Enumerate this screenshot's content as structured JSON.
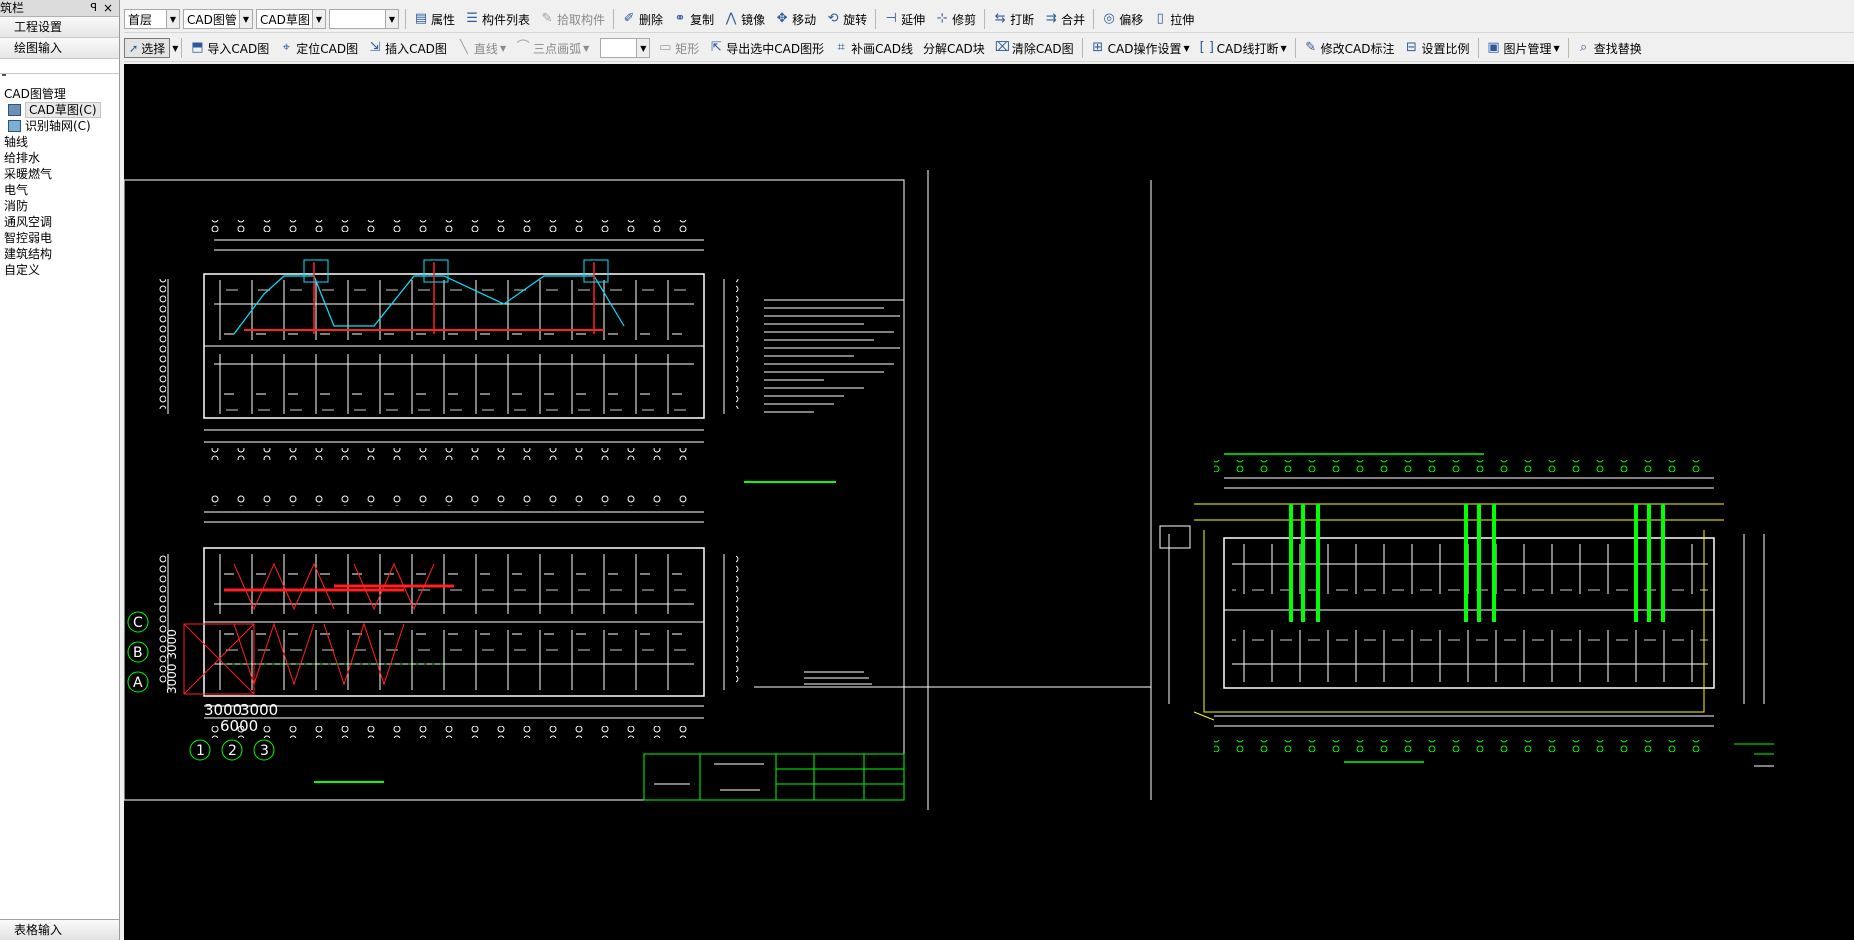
{
  "sidebar": {
    "title": "筑栏",
    "pin": "ꟼ",
    "close": "×",
    "buttons": [
      "工程设置",
      "绘图输入"
    ],
    "tree_header": "CAD图管理",
    "tree_sub": [
      "CAD草图(C)",
      "识别轴网(C)"
    ],
    "categories": [
      "轴线",
      "给排水",
      "采暖燃气",
      "电气",
      "消防",
      "通风空调",
      "智控弱电",
      "建筑结构",
      "自定义"
    ],
    "bottom": "表格输入"
  },
  "toolbar1": {
    "floor": "首层",
    "cad_mgr": "CAD图管",
    "cad_draft": "CAD草图",
    "blank": "",
    "items": [
      {
        "label": "属性",
        "icon": "props-icon"
      },
      {
        "label": "构件列表",
        "icon": "list-icon"
      },
      {
        "label": "拾取构件",
        "icon": "pick-icon",
        "dim": true
      },
      {
        "label": "删除",
        "icon": "delete-icon"
      },
      {
        "label": "复制",
        "icon": "copy-icon"
      },
      {
        "label": "镜像",
        "icon": "mirror-icon"
      },
      {
        "label": "移动",
        "icon": "move-icon"
      },
      {
        "label": "旋转",
        "icon": "rotate-icon"
      },
      {
        "label": "延伸",
        "icon": "extend-icon"
      },
      {
        "label": "修剪",
        "icon": "trim-icon"
      },
      {
        "label": "打断",
        "icon": "break-icon"
      },
      {
        "label": "合并",
        "icon": "merge-icon"
      },
      {
        "label": "偏移",
        "icon": "offset-icon"
      },
      {
        "label": "拉伸",
        "icon": "stretch-icon"
      }
    ]
  },
  "toolbar2": {
    "select": "选择",
    "items": [
      {
        "label": "导入CAD图",
        "icon": "import-cad-icon"
      },
      {
        "label": "定位CAD图",
        "icon": "locate-cad-icon"
      },
      {
        "label": "插入CAD图",
        "icon": "insert-cad-icon"
      },
      {
        "label": "直线",
        "icon": "line-icon",
        "dim": true,
        "caret": true
      },
      {
        "label": "三点画弧",
        "icon": "arc-icon",
        "dim": true,
        "caret": true
      }
    ],
    "items_b": [
      {
        "label": "矩形",
        "icon": "rect-icon",
        "dim": true
      },
      {
        "label": "导出选中CAD图形",
        "icon": "export-cad-icon"
      },
      {
        "label": "补画CAD线",
        "icon": "redraw-line-icon"
      },
      {
        "label": "分解CAD块",
        "icon": "explode-block-icon"
      },
      {
        "label": "清除CAD图",
        "icon": "clear-cad-icon"
      },
      {
        "label": "CAD操作设置",
        "icon": "cad-settings-icon",
        "caret": true
      },
      {
        "label": "CAD线打断",
        "icon": "cad-break-icon",
        "caret": true
      },
      {
        "label": "修改CAD标注",
        "icon": "edit-dim-icon"
      },
      {
        "label": "设置比例",
        "icon": "scale-icon"
      },
      {
        "label": "图片管理",
        "icon": "image-mgr-icon",
        "caret": true
      },
      {
        "label": "查找替换",
        "icon": "find-replace-icon"
      }
    ]
  },
  "canvas": {
    "grid_labels_rows": [
      "C",
      "B",
      "A"
    ],
    "grid_labels_cols": [
      "1",
      "2",
      "3"
    ],
    "dim_text_1": "3000",
    "dim_text_2": "3000",
    "dim_text_3": "6000",
    "vertical_dims": "3000 3000",
    "colors": {
      "bg": "#000000",
      "white": "#ffffff",
      "cyan": "#00e5ff",
      "red": "#ff2020",
      "green": "#00ff00",
      "yellow": "#ffff00"
    }
  }
}
